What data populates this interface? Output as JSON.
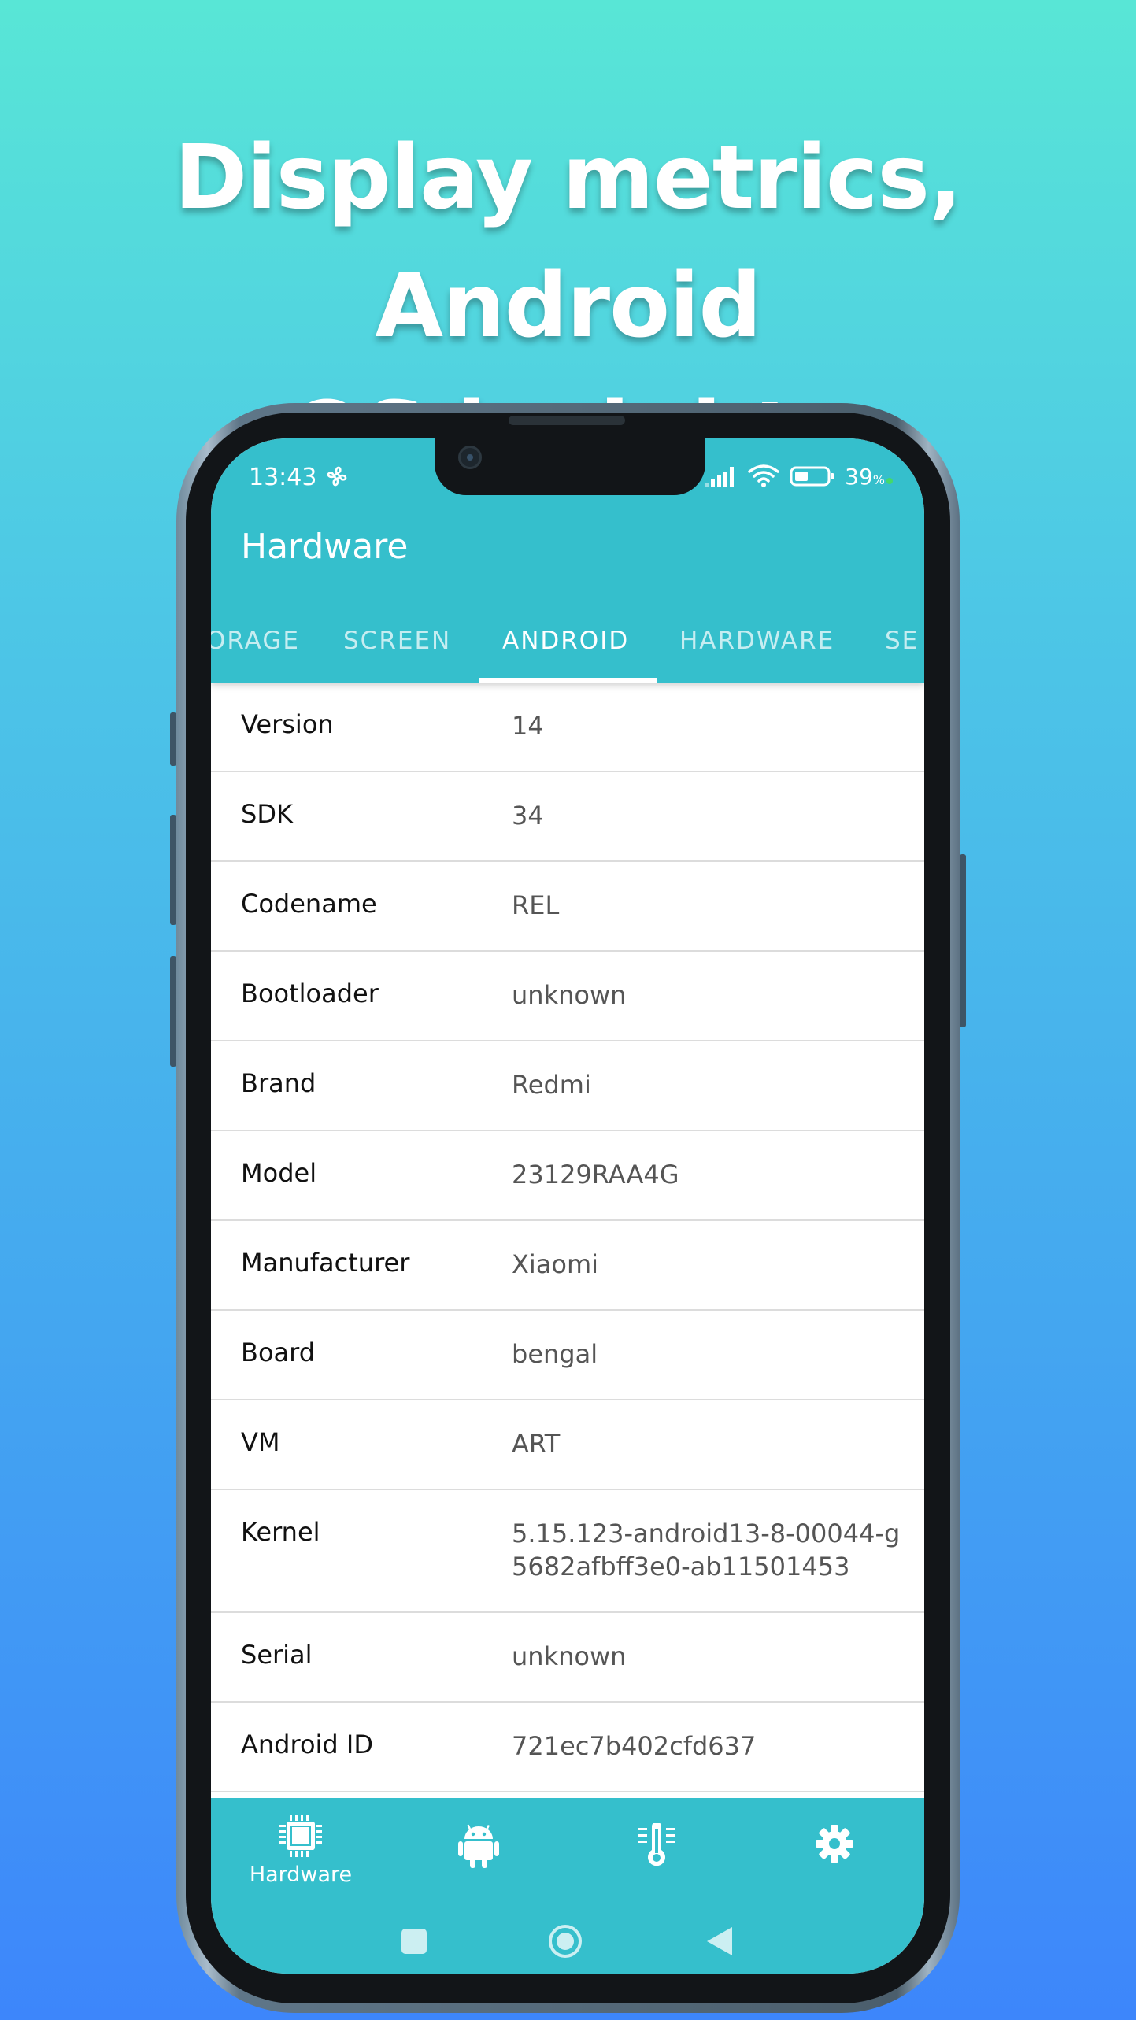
{
  "headline": {
    "line1": "Display metrics, Android",
    "line2": "OS insights"
  },
  "status_bar": {
    "time": "13:43",
    "battery": "39",
    "battery_unit": "%"
  },
  "app": {
    "title": "Hardware",
    "tabs": [
      "ORAGE",
      "SCREEN",
      "ANDROID",
      "HARDWARE",
      "SE"
    ],
    "active_tab": "ANDROID"
  },
  "rows": [
    {
      "label": "Version",
      "value": "14"
    },
    {
      "label": "SDK",
      "value": "34"
    },
    {
      "label": "Codename",
      "value": "REL"
    },
    {
      "label": "Bootloader",
      "value": "unknown"
    },
    {
      "label": "Brand",
      "value": "Redmi"
    },
    {
      "label": "Model",
      "value": "23129RAA4G"
    },
    {
      "label": "Manufacturer",
      "value": "Xiaomi"
    },
    {
      "label": "Board",
      "value": "bengal"
    },
    {
      "label": "VM",
      "value": "ART"
    },
    {
      "label": "Kernel",
      "value": "5.15.123-android13-8-00044-g5682afbff3e0-ab11501453"
    },
    {
      "label": "Serial",
      "value": "unknown"
    },
    {
      "label": "Android ID",
      "value": "721ec7b402cfd637"
    }
  ],
  "bottom_nav": [
    {
      "icon": "cpu-chip-icon",
      "label": "Hardware"
    },
    {
      "icon": "android-robot-icon",
      "label": ""
    },
    {
      "icon": "thermometer-icon",
      "label": ""
    },
    {
      "icon": "gear-icon",
      "label": ""
    }
  ],
  "colors": {
    "accent": "#35bfcc",
    "background_top": "#58e6d6",
    "background_bottom": "#3d86fb"
  }
}
